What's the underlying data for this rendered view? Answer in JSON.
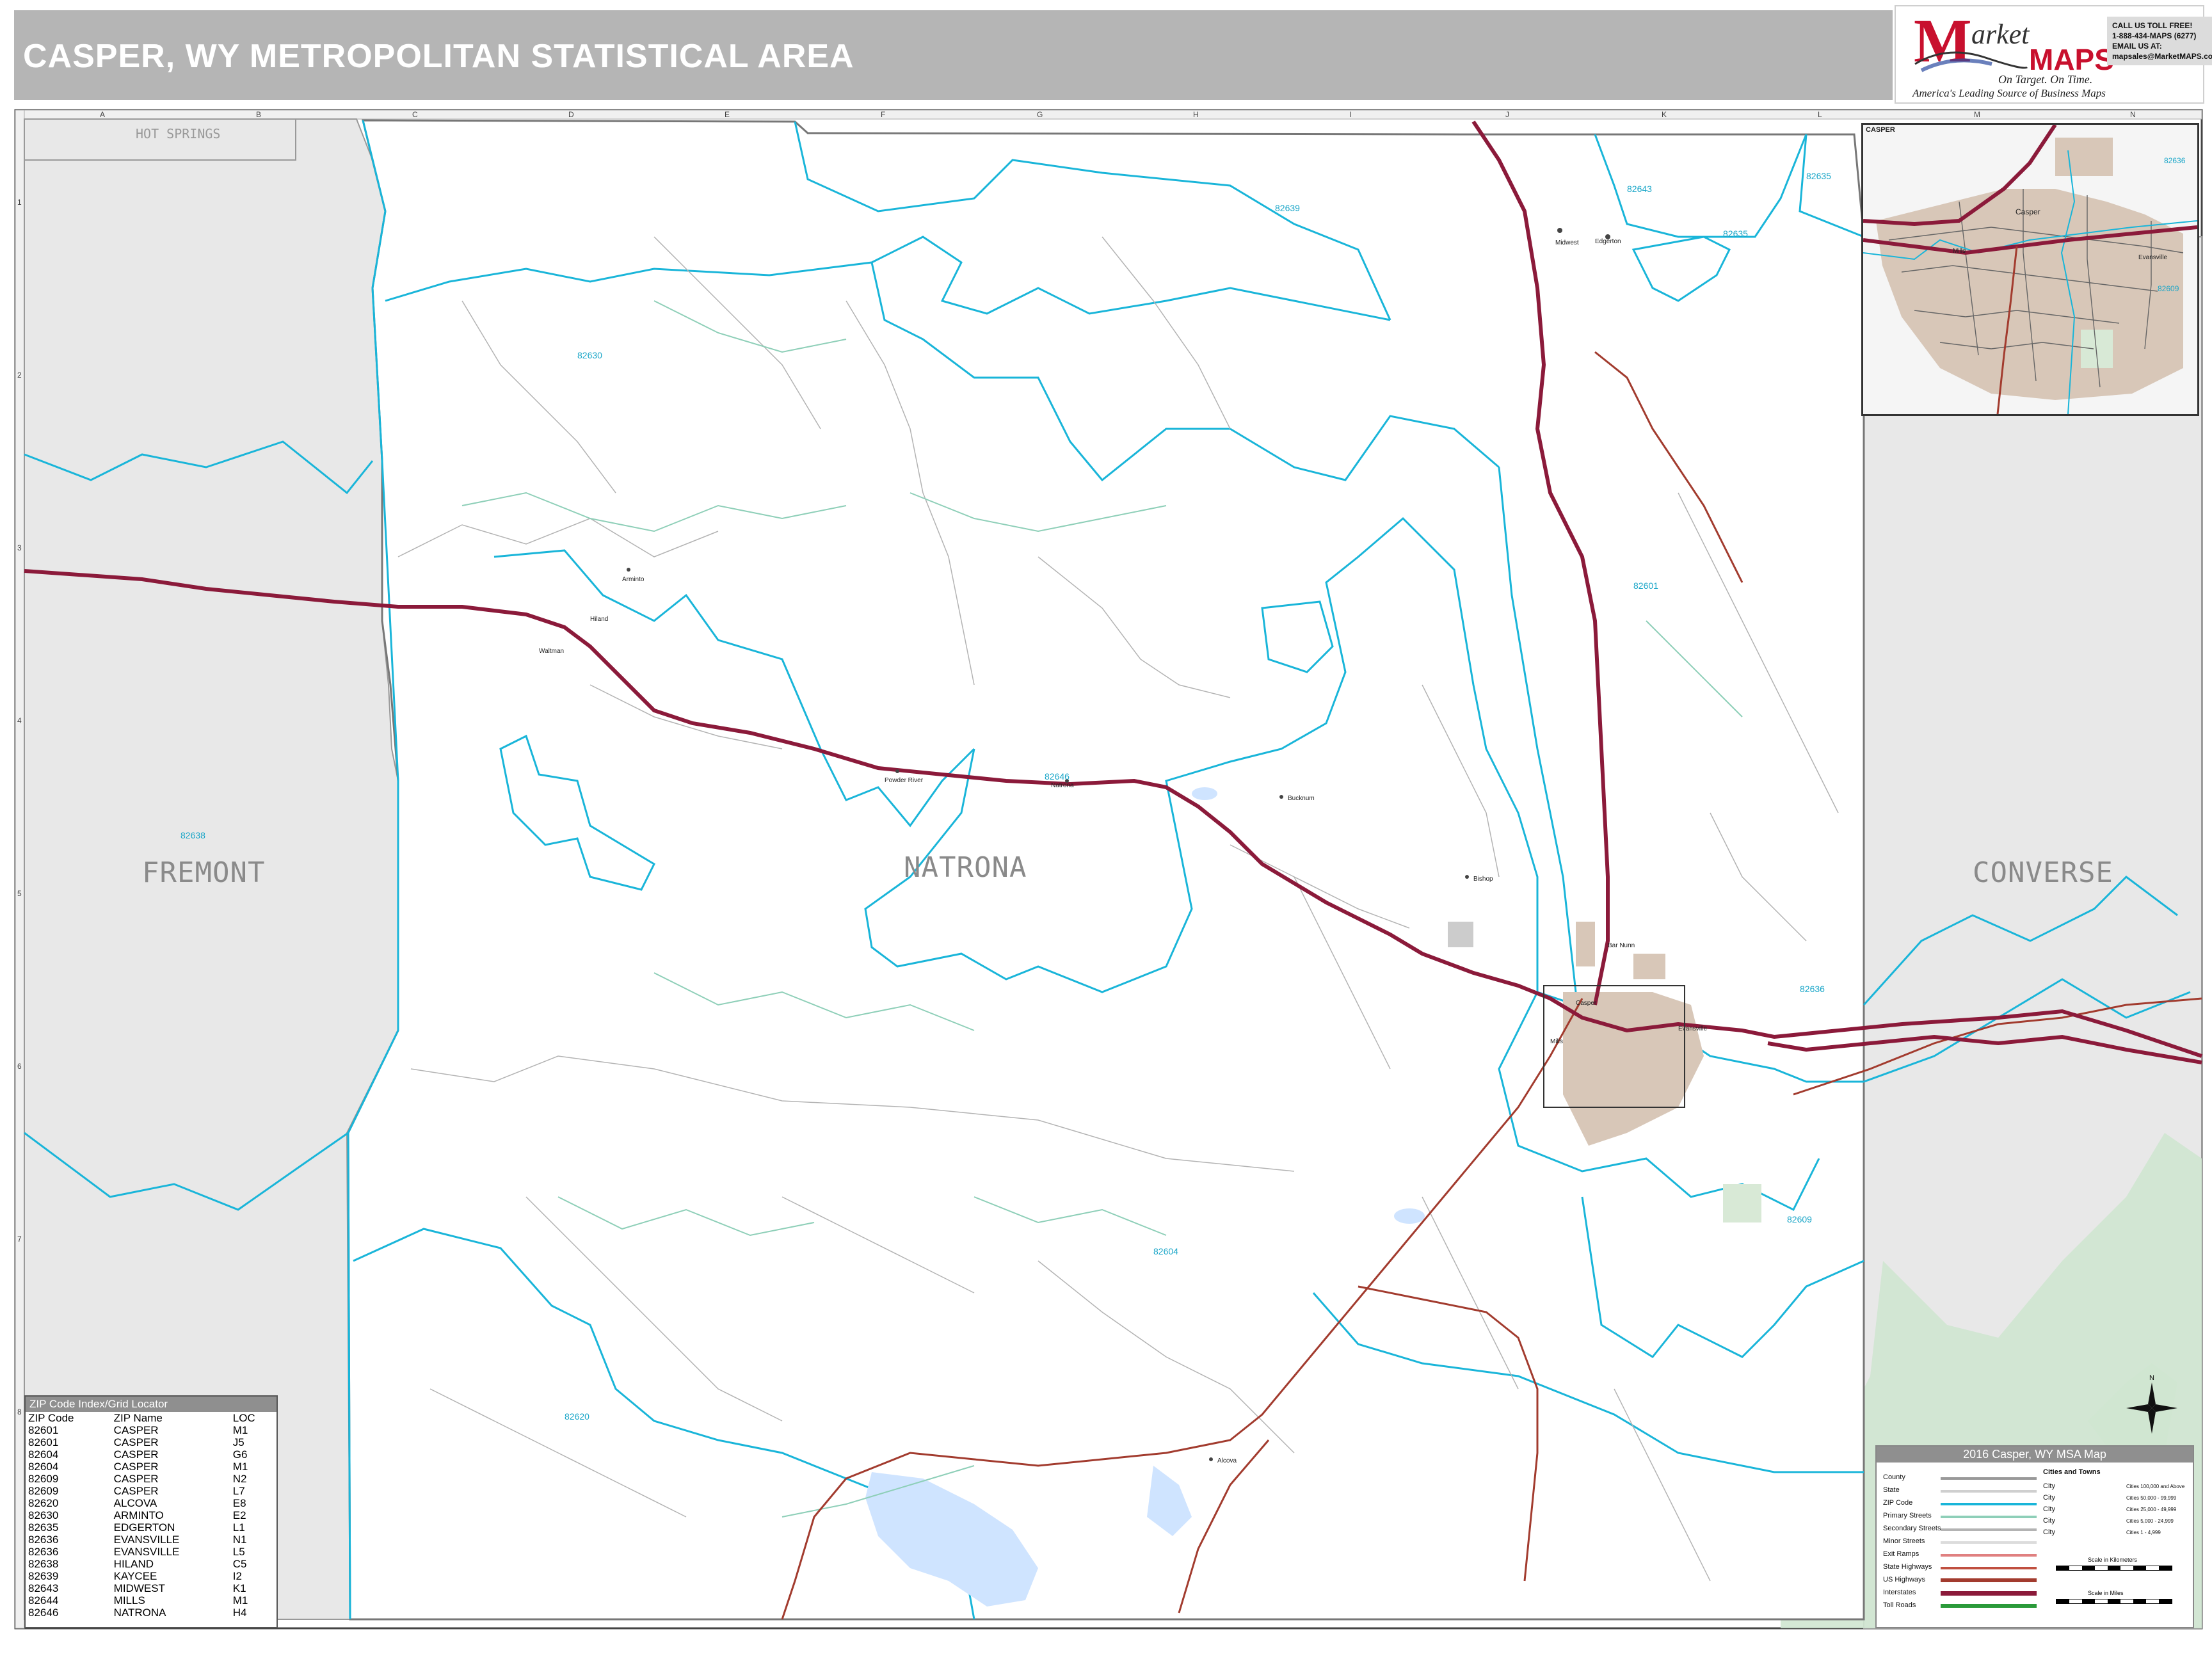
{
  "header": {
    "title": "CASPER, WY METROPOLITAN STATISTICAL AREA"
  },
  "brand": {
    "logo_m": "M",
    "logo_arket": "arket",
    "logo_maps": "MAPS",
    "tagline": "On Target.  On Time.",
    "subtagline": "America's Leading Source of Business Maps",
    "contact_lines": [
      "CALL US TOLL FREE!",
      "1-888-434-MAPS  (6277)",
      "EMAIL US AT:",
      "mapsales@MarketMAPS.com"
    ]
  },
  "grid": {
    "columns": [
      "A",
      "B",
      "C",
      "D",
      "E",
      "F",
      "G",
      "H",
      "I",
      "J",
      "K",
      "L",
      "M",
      "N"
    ],
    "rows": [
      "1",
      "2",
      "3",
      "4",
      "5",
      "6",
      "7",
      "8"
    ]
  },
  "counties": {
    "hot_springs": "HOT SPRINGS",
    "fremont": "FREMONT",
    "natrona": "NATRONA",
    "converse": "CONVERSE"
  },
  "zip_labels": {
    "z82639": "82639",
    "z82643": "82643",
    "z82635a": "82635",
    "z82635b": "82635",
    "z82630": "82630",
    "z82601": "82601",
    "z82638": "82638",
    "z82646": "82646",
    "z82636": "82636",
    "z82604": "82604",
    "z82609": "82609",
    "z82620": "82620"
  },
  "places": {
    "midwest": "Midwest",
    "edgerton": "Edgerton",
    "arminto": "Arminto",
    "powder_river": "Powder River",
    "natrona": "Natrona",
    "waltman": "Waltman",
    "hiland": "Hiland",
    "bucknum": "Bucknum",
    "alcova": "Alcova",
    "bishop": "Bishop",
    "casper": "Casper",
    "mills": "Mills",
    "evansville": "Evansville",
    "bar_nunn": "Bar Nunn"
  },
  "zip_table": {
    "title": "ZIP Code Index/Grid Locator",
    "headers": [
      "ZIP Code",
      "ZIP Name",
      "LOC"
    ],
    "rows": [
      [
        "82601",
        "CASPER",
        "M1"
      ],
      [
        "82601",
        "CASPER",
        "J5"
      ],
      [
        "82604",
        "CASPER",
        "G6"
      ],
      [
        "82604",
        "CASPER",
        "M1"
      ],
      [
        "82609",
        "CASPER",
        "N2"
      ],
      [
        "82609",
        "CASPER",
        "L7"
      ],
      [
        "82620",
        "ALCOVA",
        "E8"
      ],
      [
        "82630",
        "ARMINTO",
        "E2"
      ],
      [
        "82635",
        "EDGERTON",
        "L1"
      ],
      [
        "82636",
        "EVANSVILLE",
        "N1"
      ],
      [
        "82636",
        "EVANSVILLE",
        "L5"
      ],
      [
        "82638",
        "HILAND",
        "C5"
      ],
      [
        "82639",
        "KAYCEE",
        "I2"
      ],
      [
        "82643",
        "MIDWEST",
        "K1"
      ],
      [
        "82644",
        "MILLS",
        "M1"
      ],
      [
        "82646",
        "NATRONA",
        "H4"
      ]
    ]
  },
  "legend": {
    "title": "2016 Casper, WY MSA Map",
    "items": [
      "County",
      "State",
      "ZIP Code",
      "Primary Streets",
      "Secondary Streets",
      "Minor Streets",
      "Exit Ramps",
      "State Highways",
      "US Highways",
      "Interstates",
      "Toll Roads"
    ],
    "cities_heading": "Cities and Towns",
    "city_word": "City",
    "city_ranges": [
      "Cities 100,000 and Above",
      "Cities 50,000 - 99,999",
      "Cities 25,000 - 49,999",
      "Cities 5,000 - 24,999",
      "Cities 1 - 4,999"
    ],
    "scale_km": "Scale in Kilometers",
    "scale_mi": "Scale in Miles"
  },
  "inset": {
    "title": "CASPER",
    "zip_a": "82636",
    "zip_b": "82609",
    "label_casper": "Casper",
    "label_mills": "Mills",
    "label_evansville": "Evansville"
  },
  "colors": {
    "zip_boundary": "#19b5d9",
    "interstate": "#8b1a3a",
    "us_highway": "#a23b2e",
    "county_fill": "#e6e6e6",
    "urban": "#d8c7b8",
    "water": "#cfe4ff",
    "green_area": "#cfe6d0"
  }
}
